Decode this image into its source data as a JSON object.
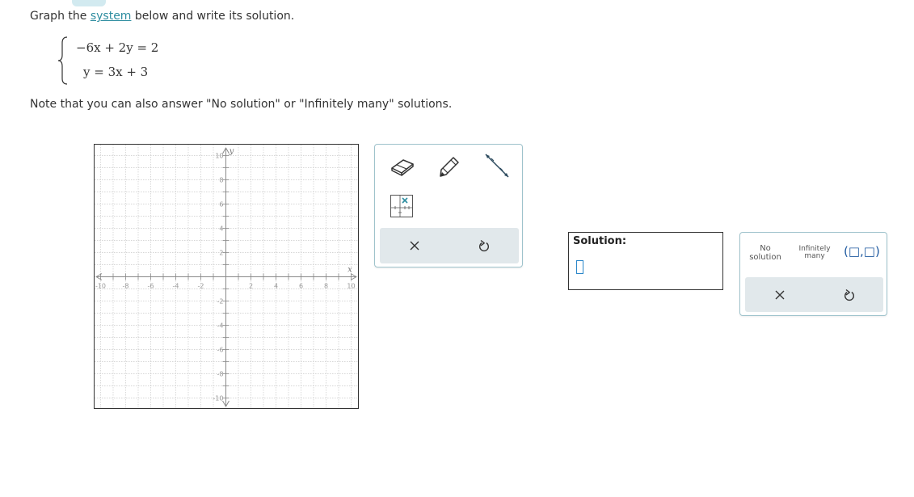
{
  "question": {
    "prefix": "Graph the ",
    "link": "system",
    "suffix": " below and write its solution.",
    "eq1": "−6x + 2y = 2",
    "eq2": "y = 3x + 3",
    "note": "Note that you can also answer \"No solution\" or \"Infinitely many\" solutions."
  },
  "graph": {
    "x_axis_label": "x",
    "y_axis_label": "y",
    "x_range": [
      -10,
      10
    ],
    "y_range": [
      -10,
      10
    ],
    "tick_labels": [
      "-10",
      "-8",
      "-6",
      "-4",
      "-2",
      "2",
      "4",
      "6",
      "8",
      "10"
    ],
    "grid": true
  },
  "tools": [
    "eraser-icon",
    "pencil-icon",
    "line-icon",
    "point-icon",
    "close-icon",
    "undo-icon"
  ],
  "solution": {
    "label": "Solution:",
    "value": ""
  },
  "answer_options": {
    "no_solution_line1": "No",
    "no_solution_line2": "solution",
    "infinitely_line1": "Infinitely",
    "infinitely_line2": "many",
    "ordered_pair": "(□,□)"
  },
  "colors": {
    "link": "#2e8da0",
    "border_accent": "#9fc3cc",
    "toolbar_bg": "#e1e8eb",
    "input_border": "#2a86c9"
  }
}
